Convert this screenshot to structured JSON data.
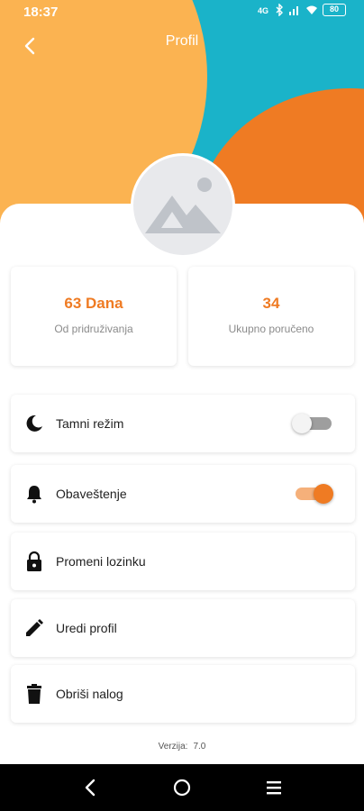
{
  "status_bar": {
    "time": "18:37",
    "battery": "80",
    "icons": [
      "data-icon",
      "bluetooth-icon",
      "signal-icon",
      "wifi-icon",
      "battery-icon"
    ]
  },
  "header": {
    "title": "Profil",
    "back_icon": "chevron-left-icon"
  },
  "colors": {
    "accent": "#ef7b23",
    "hero_teal": "#1ab3c9",
    "hero_orange": "#fbb351"
  },
  "avatar": {
    "icon": "image-placeholder-icon"
  },
  "stats": [
    {
      "value": "63 Dana",
      "label": "Od pridruživanja"
    },
    {
      "value": "34",
      "label": "Ukupno poručeno"
    }
  ],
  "settings": [
    {
      "icon": "moon-icon",
      "label": "Tamni režim",
      "toggle": false
    },
    {
      "icon": "bell-icon",
      "label": "Obaveštenje",
      "toggle": true
    },
    {
      "icon": "lock-icon",
      "label": "Promeni lozinku"
    },
    {
      "icon": "pencil-icon",
      "label": "Uredi profil"
    },
    {
      "icon": "trash-icon",
      "label": "Obriši nalog"
    }
  ],
  "version": {
    "label": "Verzija:",
    "value": "7.0"
  },
  "nav_bar": {
    "icons": [
      "back-nav-icon",
      "home-nav-icon",
      "recents-nav-icon"
    ]
  }
}
